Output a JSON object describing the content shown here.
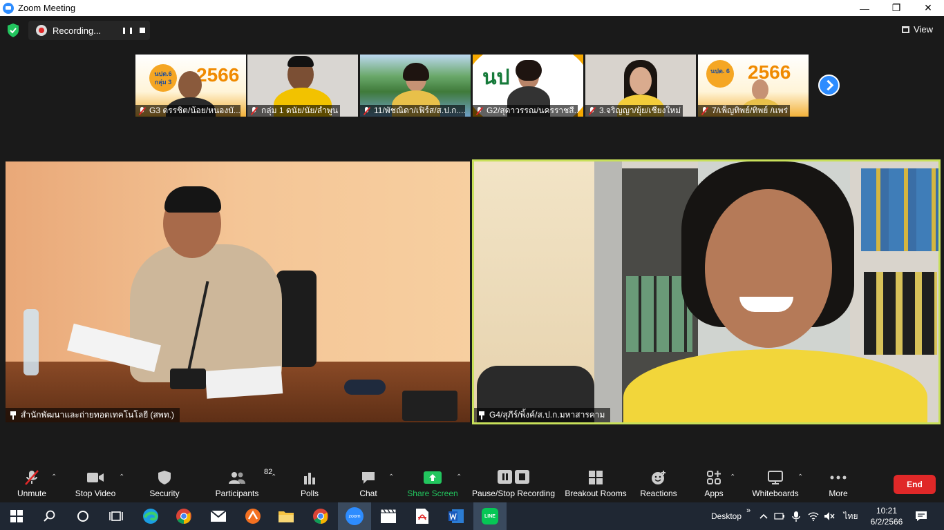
{
  "window": {
    "title": "Zoom Meeting"
  },
  "top_bar": {
    "recording_label": "Recording...",
    "view_label": "View"
  },
  "thumbnails": [
    {
      "name": "G3 ดรรชิต/น้อย/หนองบั..."
    },
    {
      "name": "กลุ่ม 1 ดนัย/นัย/ลำพูน"
    },
    {
      "name": "11/พัชณิดา/เฟิร์ส/ส.ป.ก...."
    },
    {
      "name": "G2/สุดาวรรณ/นครราชสี..."
    },
    {
      "name": "3.จริญญา/ยุ้ย/เชียงใหม่"
    },
    {
      "name": "7/เพ็ญทิพย์/ทิพย์ /แพร่"
    }
  ],
  "thumbnail_text": {
    "t1_badge": "นปต.6 กลุ่ม 3",
    "t1_year": "2566",
    "t4_text": "นป",
    "t6_badge": "นปต. 6",
    "t6_year": "2566"
  },
  "main_videos": {
    "left_name": "สำนักพัฒนาและถ่ายทอดเทคโนโลยี (สพท.)",
    "right_name": "G4/สุภีร์/พิ้งค์/ส.ป.ก.มหาสารคาม"
  },
  "toolbar": {
    "unmute": "Unmute",
    "stop_video": "Stop Video",
    "security": "Security",
    "participants": "Participants",
    "participants_count": "82",
    "polls": "Polls",
    "chat": "Chat",
    "share_screen": "Share Screen",
    "pause_stop_recording": "Pause/Stop Recording",
    "breakout_rooms": "Breakout Rooms",
    "reactions": "Reactions",
    "apps": "Apps",
    "whiteboards": "Whiteboards",
    "more": "More",
    "end": "End"
  },
  "taskbar": {
    "apps": [
      "windows-start",
      "search",
      "cortana",
      "task-view",
      "edge",
      "chrome",
      "mail",
      "app-orange",
      "file-explorer",
      "chrome-2",
      "zoom",
      "video-editor",
      "pdf",
      "word",
      "line"
    ],
    "zoom_label": "zoom",
    "line_label": "LINE",
    "desktop_label": "Desktop",
    "language": "ไทย",
    "time": "10:21",
    "date": "6/2/2566"
  },
  "colors": {
    "active_speaker_border": "#c8e05a",
    "end_red": "#e02828",
    "share_green": "#22c55e",
    "zoom_blue": "#2d8cff"
  }
}
